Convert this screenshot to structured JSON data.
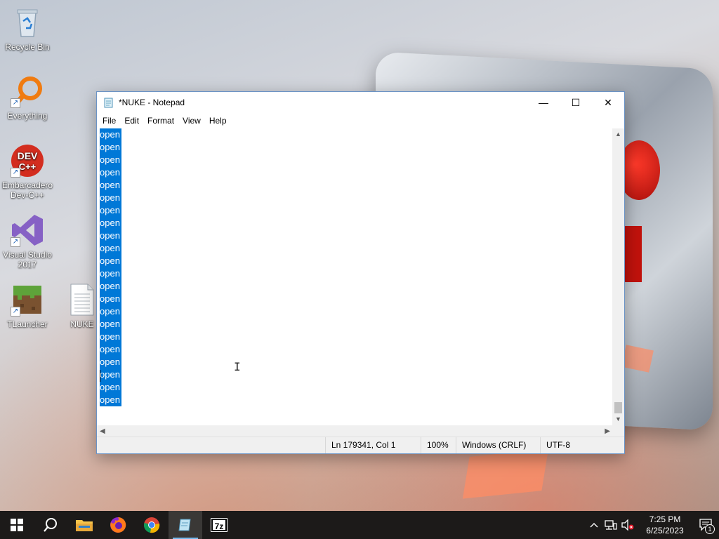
{
  "desktop": {
    "icons": [
      {
        "label": "Recycle Bin"
      },
      {
        "label": "Everything"
      },
      {
        "label": "Embarcadero Dev-C++"
      },
      {
        "label": "Visual Studio 2017"
      },
      {
        "label": "TLauncher"
      },
      {
        "label": "NUKE"
      }
    ]
  },
  "window": {
    "title": "*NUKE - Notepad",
    "menu": [
      "File",
      "Edit",
      "Format",
      "View",
      "Help"
    ],
    "controls": {
      "minimize": "—",
      "maximize": "☐",
      "close": "✕"
    },
    "editor": {
      "lines": [
        "open",
        "open",
        "open",
        "open",
        "open",
        "open",
        "open",
        "open",
        "open",
        "open",
        "open",
        "open",
        "open",
        "open",
        "open",
        "open",
        "open",
        "open",
        "open",
        "open",
        "open",
        "open"
      ],
      "selection_color": "#0078d7"
    },
    "status": {
      "position": "Ln 179341, Col 1",
      "zoom": "100%",
      "line_endings": "Windows (CRLF)",
      "encoding": "UTF-8"
    }
  },
  "taskbar": {
    "apps": [
      "start-icon",
      "search-icon",
      "file-explorer-icon",
      "firefox-icon",
      "chrome-icon",
      "notepad-icon",
      "7zip-icon"
    ],
    "sevenzip_label": "7z",
    "clock": {
      "time": "7:25 PM",
      "date": "6/25/2023"
    },
    "notification_count": "1"
  }
}
